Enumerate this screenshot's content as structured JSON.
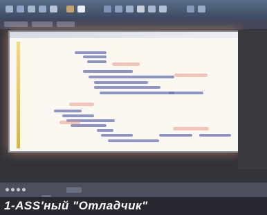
{
  "caption": "1-ASS'ный \"Отладчик\""
}
